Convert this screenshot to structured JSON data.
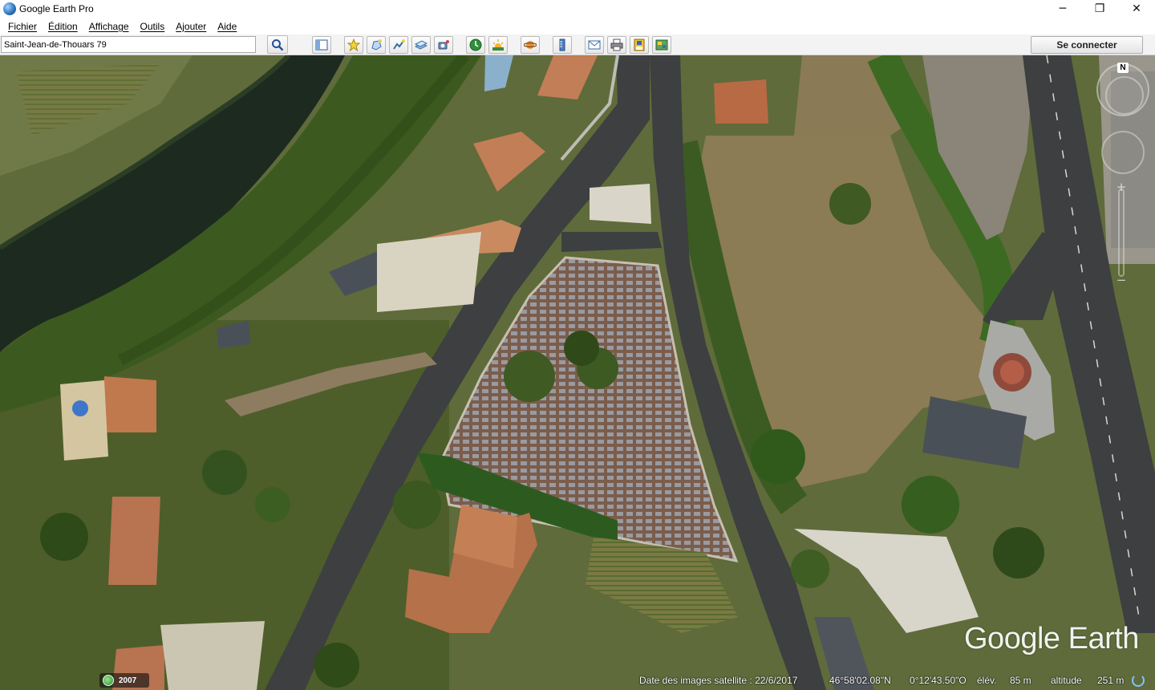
{
  "app": {
    "title": "Google Earth Pro",
    "window_controls": {
      "minimize": "─",
      "maximize": "❐",
      "close": "✕"
    }
  },
  "menu": {
    "items": [
      "Fichier",
      "Édition",
      "Affichage",
      "Outils",
      "Ajouter",
      "Aide"
    ]
  },
  "toolbar": {
    "search_value": "Saint-Jean-de-Thouars 79",
    "connect_label": "Se connecter",
    "tools": [
      "sidebar-toggle-icon",
      "placemark-icon",
      "polygon-icon",
      "path-icon",
      "overlay-icon",
      "tour-icon",
      "historical-imagery-icon",
      "sunlight-icon",
      "planets-icon",
      "ruler-icon",
      "email-icon",
      "print-icon",
      "save-image-icon",
      "maps-view-icon"
    ]
  },
  "map": {
    "watermark": "Google Earth",
    "compass_label": "N",
    "zoom_in": "+",
    "zoom_out": "−"
  },
  "status": {
    "year": "2007",
    "imagery_date": "Date des images satellite : 22/6/2017",
    "latitude": "46°58'02.08\"N",
    "longitude": "0°12'43.50\"O",
    "elevation_label": "élév.",
    "elevation_value": "85 m",
    "altitude_label": "altitude",
    "altitude_value": "251 m"
  },
  "colors": {
    "river": "#1d2a20",
    "road": "#3d3f40",
    "field": "#8b7c55",
    "vegetation": "#3f5a22",
    "roof_tile": "#b5714a",
    "roof_slate": "#4a5058"
  }
}
